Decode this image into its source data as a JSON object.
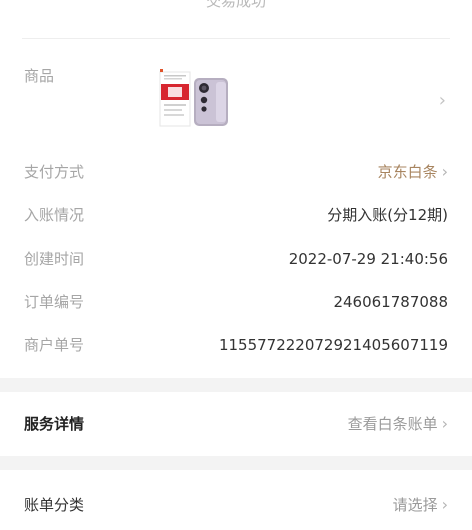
{
  "header": {
    "status": "交易成功"
  },
  "order": {
    "product_label": "商品",
    "payment_label": "支付方式",
    "payment_value": "京东白条",
    "booking_label": "入账情况",
    "booking_value": "分期入账(分12期)",
    "created_label": "创建时间",
    "created_value": "2022-07-29 21:40:56",
    "order_no_label": "订单编号",
    "order_no_value": "246061787088",
    "merchant_no_label": "商户单号",
    "merchant_no_value": "115577222072921405607119"
  },
  "service": {
    "label": "服务详情",
    "action": "查看白条账单"
  },
  "category": {
    "label": "账单分类",
    "action": "请选择"
  },
  "icons": {
    "chevron": "chevron-right-icon"
  },
  "colors": {
    "accent": "#a88560",
    "background": "#f3f3f3"
  }
}
